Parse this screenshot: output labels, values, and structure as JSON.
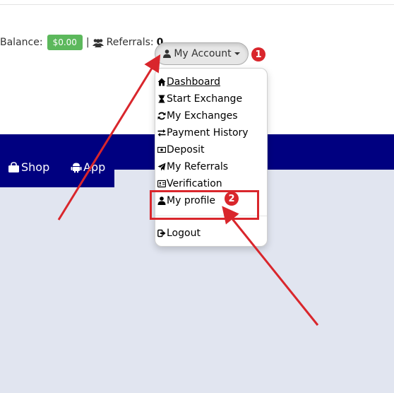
{
  "header": {
    "balance_label": "Balance:",
    "balance_value": "$0.00",
    "separator": "|",
    "referrals_label": "Referrals:",
    "referrals_value": "0"
  },
  "account_button": {
    "label": "My Account"
  },
  "dropdown": {
    "items": [
      {
        "label": "Dashboard",
        "icon": "home-icon"
      },
      {
        "label": "Start Exchange",
        "icon": "hourglass-icon"
      },
      {
        "label": "My Exchanges",
        "icon": "refresh-icon"
      },
      {
        "label": "Payment History",
        "icon": "exchange-icon"
      },
      {
        "label": "Deposit",
        "icon": "money-icon"
      },
      {
        "label": "My Referrals",
        "icon": "paper-plane-icon"
      },
      {
        "label": "Verification",
        "icon": "id-card-icon"
      },
      {
        "label": "My profile",
        "icon": "user-icon"
      },
      {
        "label": "Logout",
        "icon": "sign-out-icon"
      }
    ]
  },
  "nav": {
    "items": [
      {
        "label": "Shop",
        "icon": "shopping-bag-icon"
      },
      {
        "label": "App",
        "icon": "android-icon"
      }
    ]
  },
  "annotations": {
    "step1": "1",
    "step2": "2"
  },
  "colors": {
    "navbar": "#000080",
    "balance_badge": "#5cb85c",
    "annotation_red": "#d9262c",
    "content_bg": "#e1e5f0"
  }
}
